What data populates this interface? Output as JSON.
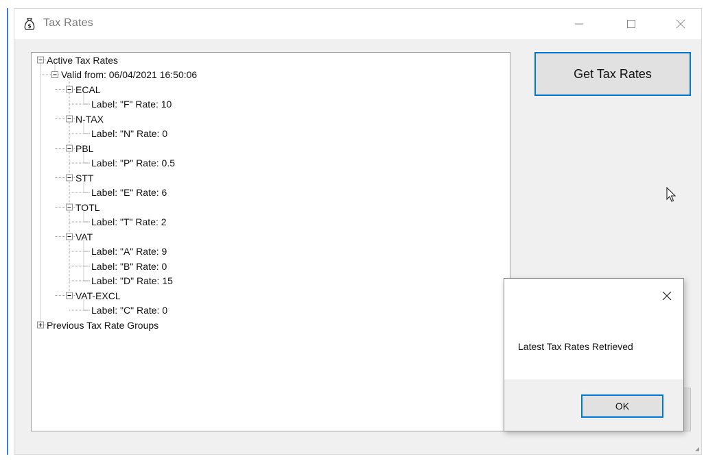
{
  "window": {
    "title": "Tax Rates",
    "icon": "money-bag-icon"
  },
  "tree": {
    "root": "Active Tax Rates",
    "valid_from": "Valid from: 06/04/2021 16:50:06",
    "groups": [
      {
        "name": "ECAL",
        "labels": [
          "Label: \"F\" Rate: 10"
        ]
      },
      {
        "name": "N-TAX",
        "labels": [
          "Label: \"N\" Rate: 0"
        ]
      },
      {
        "name": "PBL",
        "labels": [
          "Label: \"P\" Rate: 0.5"
        ]
      },
      {
        "name": "STT",
        "labels": [
          "Label: \"E\" Rate: 6"
        ]
      },
      {
        "name": "TOTL",
        "labels": [
          "Label: \"T\" Rate: 2"
        ]
      },
      {
        "name": "VAT",
        "labels": [
          "Label: \"A\" Rate: 9",
          "Label: \"B\" Rate: 0",
          "Label: \"D\" Rate: 15"
        ]
      },
      {
        "name": "VAT-EXCL",
        "labels": [
          "Label: \"C\" Rate: 0"
        ]
      }
    ],
    "previous": "Previous Tax Rate Groups"
  },
  "buttons": {
    "get_tax_rates": "Get Tax Rates"
  },
  "dialog": {
    "message": "Latest Tax Rates Retrieved",
    "ok_label": "OK"
  },
  "colors": {
    "accent": "#0078d7",
    "tree_line": "#a0a0a0"
  }
}
